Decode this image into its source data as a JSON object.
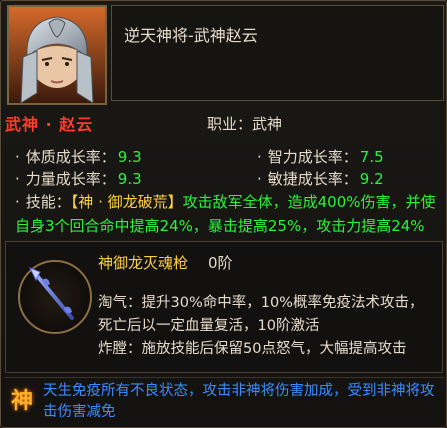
{
  "hero": {
    "title": "逆天神将-武神赵云",
    "name": "武神 · 赵云",
    "job_label": "职业：",
    "job_value": "武神"
  },
  "stats": [
    {
      "label": "体质成长率：",
      "value": "9.3"
    },
    {
      "label": "智力成长率：",
      "value": "7.5"
    },
    {
      "label": "力量成长率：",
      "value": "9.3"
    },
    {
      "label": "敏捷成长率：",
      "value": "9.2"
    }
  ],
  "skill": {
    "label": "技能：",
    "name": "【神 · 御龙破荒】",
    "desc": "攻击敌军全体，造成400%伤害，并使自身3个回合命中提高24%，暴击提高25%，攻击力提高24%"
  },
  "weapon": {
    "name": "神御龙灭魂枪",
    "tier": "0阶",
    "line1": "淘气：提升30%命中率，10%概率免疫法术攻击，",
    "line2": "死亡后以一定血量复活，10阶激活",
    "line3": "炸膛：施放技能后保留50点怒气，大幅提高攻击"
  },
  "divine": {
    "glyph": "神",
    "text": "天生免疫所有不良状态，攻击非神将伤害加成，受到非神将攻击伤害减免"
  },
  "colors": {
    "hero_name": "#ff3b2a",
    "stat_value": "#28f43a",
    "skill_name": "#ffd23a",
    "divine_text": "#3a8cff"
  }
}
